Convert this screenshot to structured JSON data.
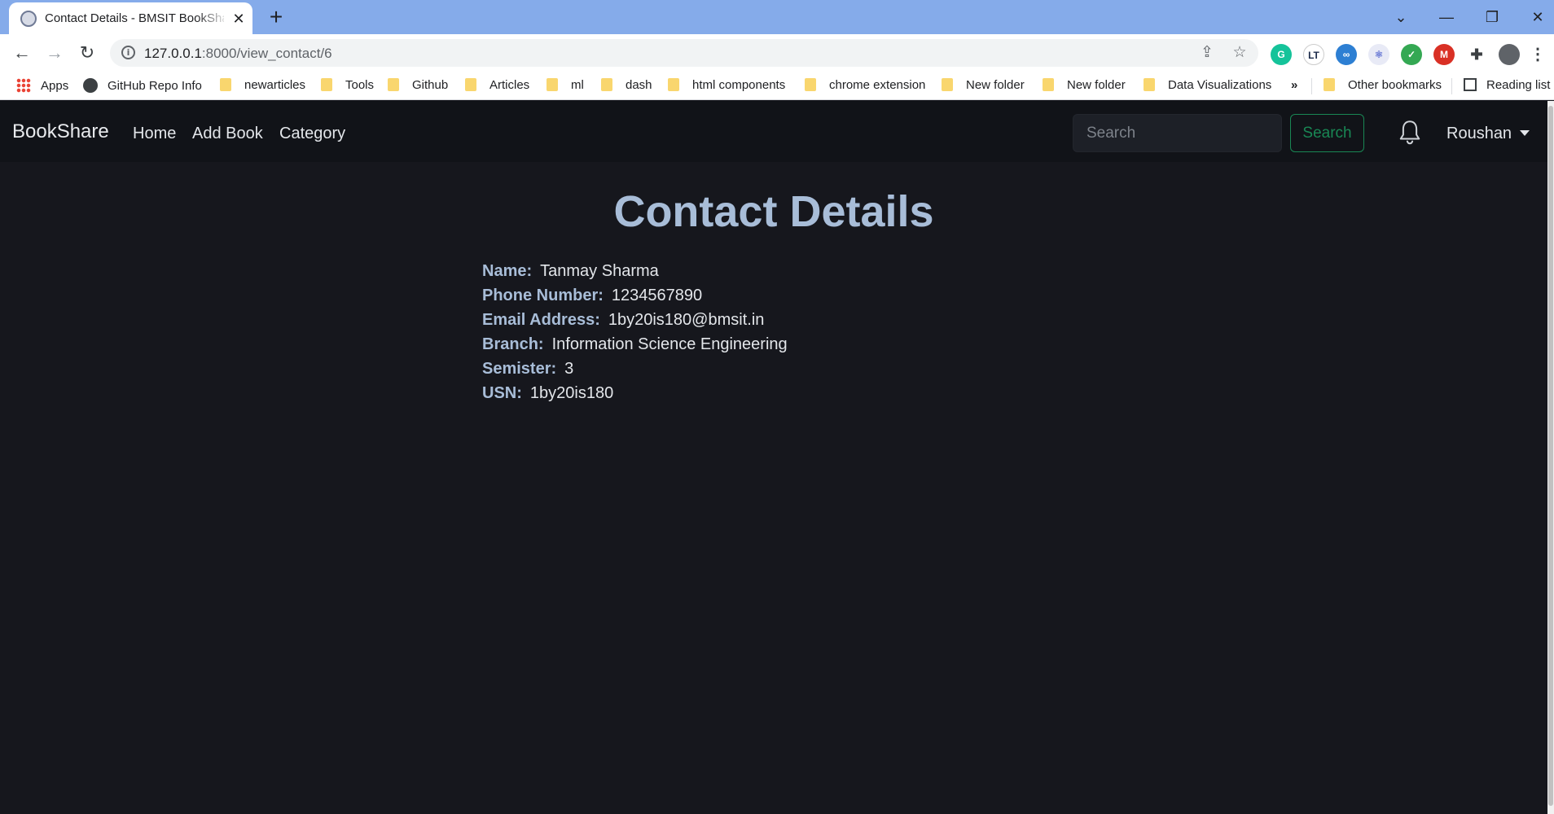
{
  "browser": {
    "tab_title": "Contact Details - BMSIT BookShare",
    "url_host": "127.0.0.1",
    "url_path": ":8000/view_contact/6",
    "bookmarks": [
      "Apps",
      "GitHub Repo Info",
      "newarticles",
      "Tools",
      "Github",
      "Articles",
      "ml",
      "dash",
      "html components",
      "chrome extension",
      "New folder",
      "New folder",
      "Data Visualizations"
    ],
    "overflow_label": "»",
    "other_bookmarks": "Other bookmarks",
    "reading_list": "Reading list"
  },
  "navbar": {
    "brand": "BookShare",
    "links": [
      "Home",
      "Add Book",
      "Category"
    ],
    "search_placeholder": "Search",
    "search_button": "Search",
    "user": "Roushan"
  },
  "contact": {
    "title": "Contact Details",
    "fields": [
      {
        "label": "Name:",
        "value": "Tanmay Sharma"
      },
      {
        "label": "Phone Number:",
        "value": "1234567890"
      },
      {
        "label": "Email Address:",
        "value": "1by20is180@bmsit.in"
      },
      {
        "label": "Branch:",
        "value": "Information Science Engineering"
      },
      {
        "label": "Semister:",
        "value": "3"
      },
      {
        "label": "USN:",
        "value": "1by20is180"
      }
    ]
  },
  "colors": {
    "page_bg": "#16171d",
    "navbar_bg": "#111318",
    "heading": "#a8bdd8",
    "success": "#198754",
    "tabstrip": "#85abea"
  }
}
